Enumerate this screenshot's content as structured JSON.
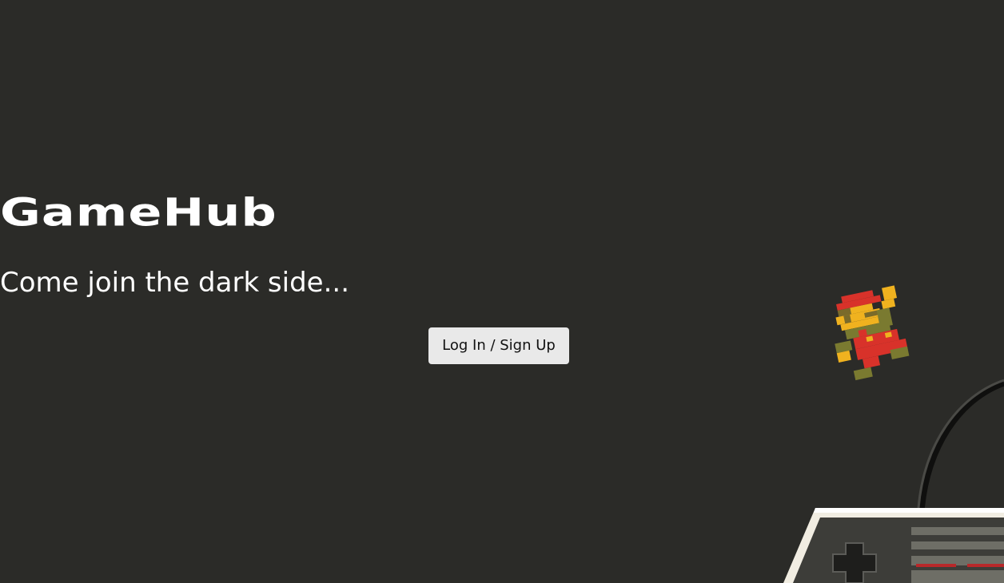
{
  "brand": {
    "logo_text": "GameHub",
    "tagline": "Come join the dark side..."
  },
  "actions": {
    "login_label": "Log In / Sign Up"
  },
  "colors": {
    "background": "#2b2b28",
    "text": "#ffffff",
    "button_bg": "#e9e9e9"
  },
  "decorations": {
    "character_icon": "pixel-plumber-jumping",
    "controller_icon": "retro-gamepad"
  }
}
